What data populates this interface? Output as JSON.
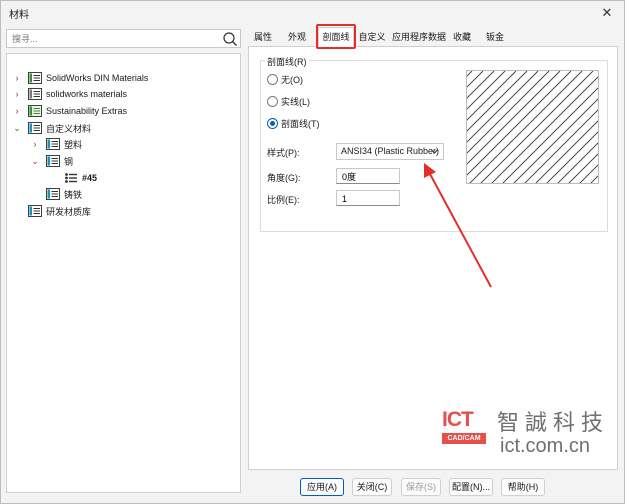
{
  "window": {
    "title": "材料",
    "close": "✕"
  },
  "search": {
    "placeholder": "搜寻..."
  },
  "tree": {
    "items": [
      {
        "label": "SolidWorks DIN Materials",
        "color": "#3f8f3a"
      },
      {
        "label": "solidworks materials",
        "color": "#3f8f3a"
      },
      {
        "label": "Sustainability Extras",
        "color": "#3f8f3a"
      },
      {
        "label": "自定义材料",
        "color": "#1e8fbf"
      },
      {
        "label": "塑料",
        "color": "#1e8fbf"
      },
      {
        "label": "钢",
        "color": "#1e8fbf"
      },
      {
        "label": "#45"
      },
      {
        "label": "铸铁",
        "color": "#1e8fbf"
      },
      {
        "label": "研发材质库",
        "color": "#1e8fbf"
      }
    ]
  },
  "tabs": [
    {
      "label": "属性"
    },
    {
      "label": "外观"
    },
    {
      "label": "剖面线"
    },
    {
      "label": "自定义"
    },
    {
      "label": "应用程序数据"
    },
    {
      "label": "收藏"
    },
    {
      "label": "钣金"
    }
  ],
  "hatch": {
    "group_label": "剖面线(R)",
    "options": [
      {
        "label": "无(O)",
        "checked": false
      },
      {
        "label": "实线(L)",
        "checked": false
      },
      {
        "label": "剖面线(T)",
        "checked": true
      }
    ],
    "style_label": "样式(P):",
    "style_value": "ANSI34 (Plastic Rubber)",
    "angle_label": "角度(G):",
    "angle_value": "0度",
    "scale_label": "比例(E):",
    "scale_value": "1"
  },
  "logo": {
    "badge": "ICT",
    "badge_sub": "CAD/CAM",
    "name": "智誠科技",
    "url": "ict.com.cn"
  },
  "buttons": {
    "apply": "应用(A)",
    "close": "关闭(C)",
    "save": "保存(S)",
    "config": "配置(N)...",
    "help": "帮助(H)"
  },
  "colors": {
    "accent": "#005fb8",
    "highlight": "#e0302b",
    "logo": "#e5504b"
  }
}
